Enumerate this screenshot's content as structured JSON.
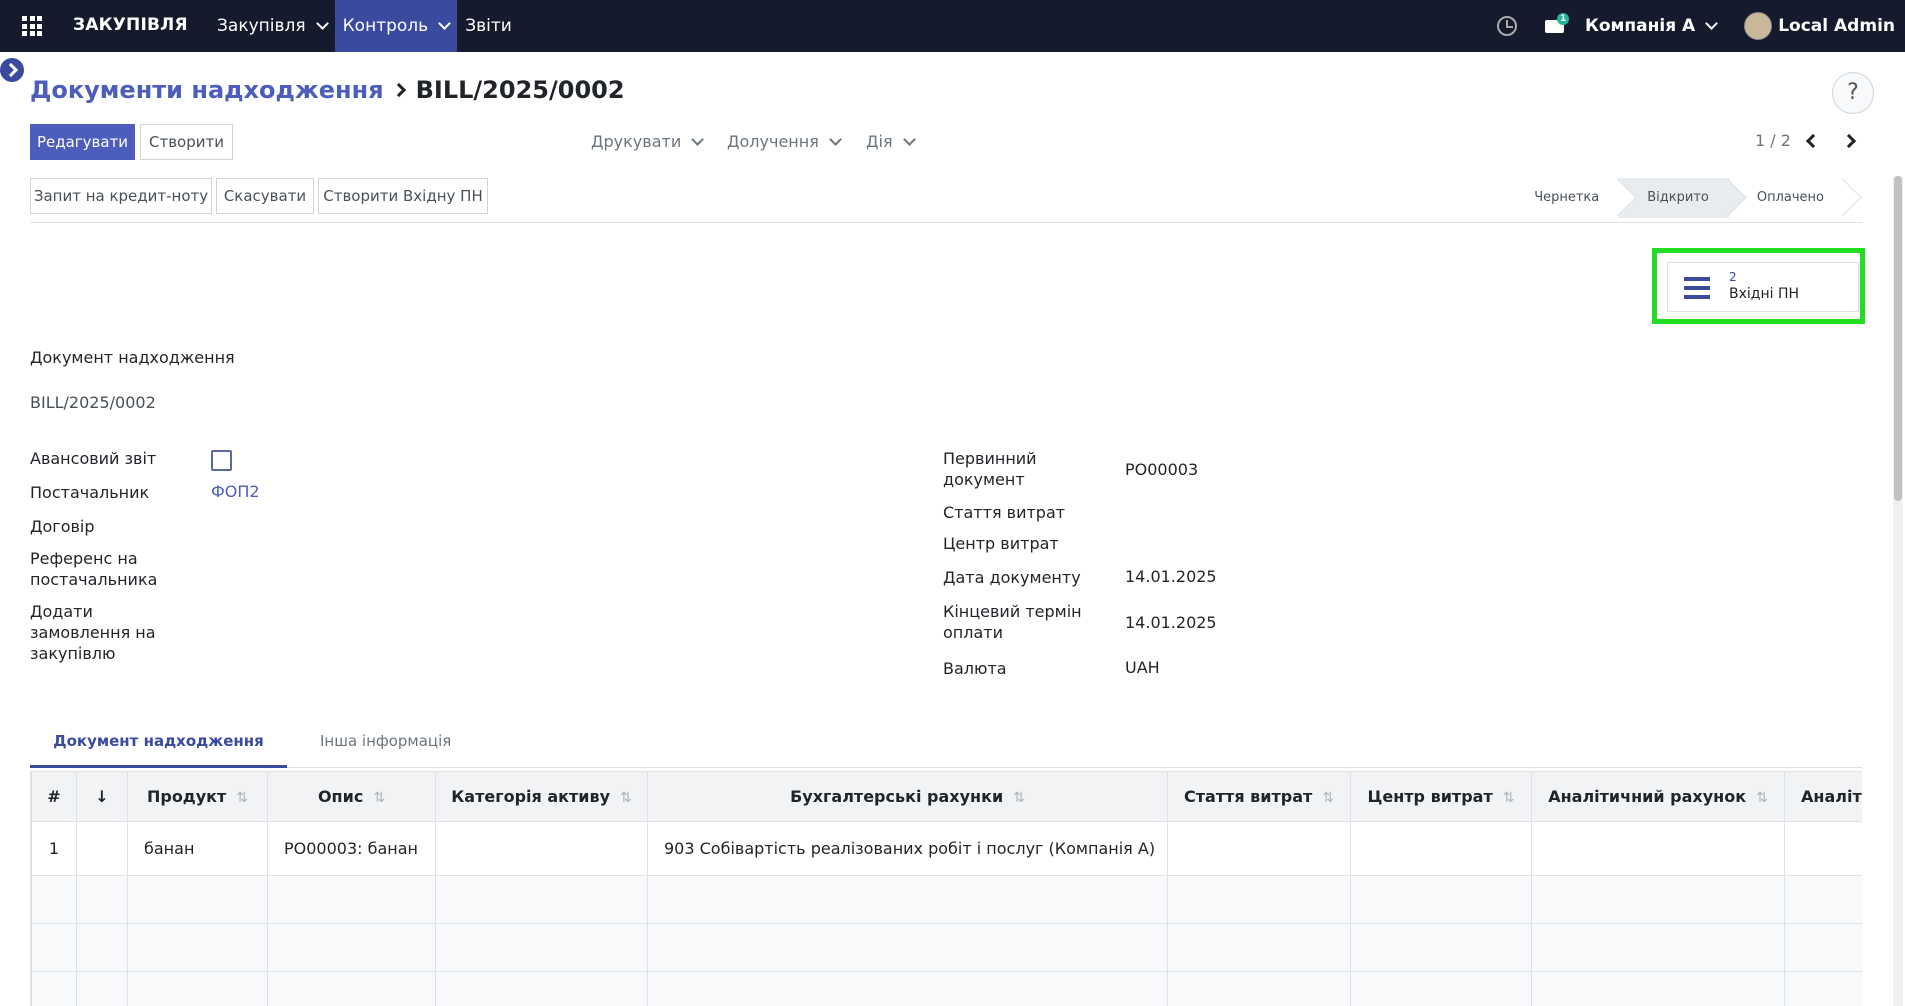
{
  "navbar": {
    "brand": "ЗАКУПІВЛЯ",
    "menu": [
      "Закупівля",
      "Контроль",
      "Звіти"
    ],
    "chat_badge": "1",
    "company": "Компанія А",
    "user": "Local Admin"
  },
  "breadcrumb": {
    "parent": "Документи надходження",
    "current": "BILL/2025/0002"
  },
  "help": "?",
  "toolbar": {
    "edit": "Редагувати",
    "create": "Створити",
    "print": "Друкувати",
    "attach": "Долучення",
    "action": "Дія",
    "pager": "1 / 2"
  },
  "statusbar": {
    "buttons": [
      "Запит на кредит-ноту",
      "Скасувати",
      "Створити Вхідну ПН"
    ],
    "stages": [
      "Чернетка",
      "Відкрито",
      "Оплачено"
    ],
    "current_stage": "Відкрито"
  },
  "smart_button": {
    "count": "2",
    "label": "Вхідні ПН"
  },
  "form": {
    "title_label": "Документ надходження",
    "doc_number": "BILL/2025/0002",
    "left": {
      "advance_label": "Авансовий звіт",
      "advance_checked": false,
      "vendor_label": "Постачальник",
      "vendor_value": "ФОП2",
      "contract_label": "Договір",
      "vendor_ref_label_1": "Референс на",
      "vendor_ref_label_2": "постачальника",
      "add_po_label_1": "Додати",
      "add_po_label_2": "замовлення на",
      "add_po_label_3": "закупівлю"
    },
    "right": {
      "source_label_1": "Первинний",
      "source_label_2": "документ",
      "source_value": "PO00003",
      "expense_item_label": "Стаття витрат",
      "cost_center_label": "Центр витрат",
      "doc_date_label": "Дата документу",
      "doc_date_value": "14.01.2025",
      "due_label_1": "Кінцевий термін",
      "due_label_2": "оплати",
      "due_value": "14.01.2025",
      "currency_label": "Валюта",
      "currency_value": "UAH"
    }
  },
  "tabs": {
    "active": "Документ надходження",
    "other": "Інша інформація"
  },
  "table": {
    "headers": [
      "#",
      "↓",
      "Продукт",
      "Опис",
      "Категорія активу",
      "Бухгалтерські рахунки",
      "Стаття витрат",
      "Центр витрат",
      "Аналітичний рахунок",
      "Аналіт"
    ],
    "rows": [
      [
        "1",
        "",
        "банан",
        "PO00003: банан",
        "",
        "903 Собівартість реалізованих робіт і послуг (Компанія А)",
        "",
        "",
        "",
        ""
      ]
    ]
  }
}
